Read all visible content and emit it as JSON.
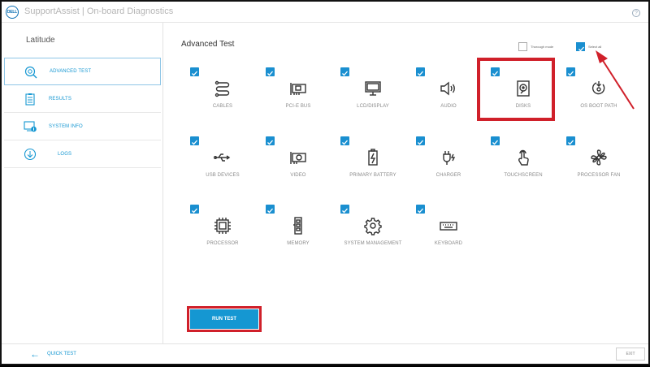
{
  "app": {
    "title": "SupportAssist | On-board Diagnostics",
    "logo_text": "DELL"
  },
  "sidebar": {
    "device": "Latitude",
    "items": [
      {
        "label": "ADVANCED TEST",
        "icon": "search-icon",
        "active": true
      },
      {
        "label": "RESULTS",
        "icon": "clipboard-icon",
        "active": false
      },
      {
        "label": "SYSTEM INFO",
        "icon": "monitor-info-icon",
        "active": false
      },
      {
        "label": "LOGS",
        "icon": "download-icon",
        "active": false
      }
    ]
  },
  "main": {
    "title": "Advanced Test",
    "thorough_mode": {
      "label": "Thorough mode",
      "checked": false
    },
    "select_all": {
      "label": "Select all",
      "checked": true
    },
    "tests": [
      {
        "label": "CABLES",
        "icon": "cable-icon",
        "checked": true
      },
      {
        "label": "PCI-E BUS",
        "icon": "pci-card-icon",
        "checked": true
      },
      {
        "label": "LCD/DISPLAY",
        "icon": "monitor-icon",
        "checked": true
      },
      {
        "label": "AUDIO",
        "icon": "speaker-icon",
        "checked": true
      },
      {
        "label": "DISKS",
        "icon": "disk-icon",
        "checked": true
      },
      {
        "label": "OS BOOT PATH",
        "icon": "boot-icon",
        "checked": true
      },
      {
        "label": "USB DEVICES",
        "icon": "usb-icon",
        "checked": true
      },
      {
        "label": "VIDEO",
        "icon": "video-card-icon",
        "checked": true
      },
      {
        "label": "PRIMARY BATTERY",
        "icon": "battery-icon",
        "checked": true
      },
      {
        "label": "CHARGER",
        "icon": "plug-icon",
        "checked": true
      },
      {
        "label": "TOUCHSCREEN",
        "icon": "touch-icon",
        "checked": true
      },
      {
        "label": "PROCESSOR FAN",
        "icon": "fan-icon",
        "checked": true
      },
      {
        "label": "PROCESSOR",
        "icon": "chip-icon",
        "checked": true
      },
      {
        "label": "MEMORY",
        "icon": "memory-icon",
        "checked": true
      },
      {
        "label": "SYSTEM MANAGEMENT",
        "icon": "gear-icon",
        "checked": true
      },
      {
        "label": "KEYBOARD",
        "icon": "keyboard-icon",
        "checked": true
      }
    ],
    "run_button": "RUN TEST"
  },
  "footer": {
    "quick_test": "QUICK TEST",
    "exit": "EXIT"
  },
  "colors": {
    "accent": "#1597d2",
    "checkbox": "#1a8fd0",
    "highlight": "#d0202a"
  }
}
